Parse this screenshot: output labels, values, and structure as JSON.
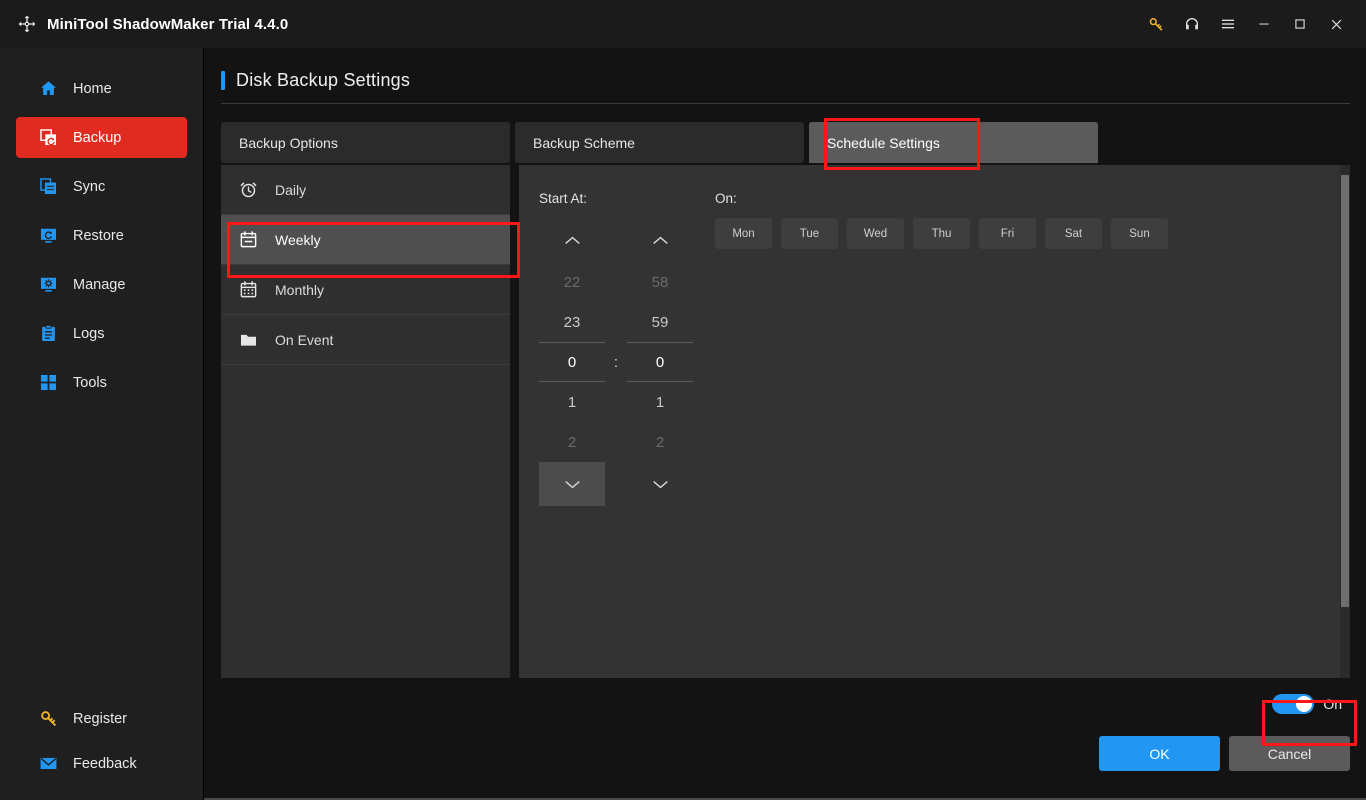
{
  "window": {
    "title": "MiniTool ShadowMaker Trial 4.4.0",
    "logo_icon": "shadowmaker-logo-icon",
    "controls": [
      {
        "name": "key-icon",
        "label": "Register",
        "glyph": "key"
      },
      {
        "name": "headphones-icon",
        "label": "Support",
        "glyph": "headphones"
      },
      {
        "name": "menu-icon",
        "label": "Menu",
        "glyph": "hamburger"
      },
      {
        "name": "minimize-icon",
        "label": "Minimize",
        "glyph": "minimize"
      },
      {
        "name": "maximize-icon",
        "label": "Maximize",
        "glyph": "maximize"
      },
      {
        "name": "close-icon",
        "label": "Close",
        "glyph": "close"
      }
    ]
  },
  "sidebar": {
    "items": [
      {
        "label": "Home",
        "icon": "home-icon",
        "active": false
      },
      {
        "label": "Backup",
        "icon": "backup-icon",
        "active": true
      },
      {
        "label": "Sync",
        "icon": "sync-icon",
        "active": false
      },
      {
        "label": "Restore",
        "icon": "restore-icon",
        "active": false
      },
      {
        "label": "Manage",
        "icon": "manage-icon",
        "active": false
      },
      {
        "label": "Logs",
        "icon": "logs-icon",
        "active": false
      },
      {
        "label": "Tools",
        "icon": "tools-icon",
        "active": false
      }
    ],
    "bottom_items": [
      {
        "label": "Register",
        "icon": "key-icon"
      },
      {
        "label": "Feedback",
        "icon": "mail-icon"
      }
    ]
  },
  "page": {
    "title": "Disk Backup Settings",
    "accent_color": "#2196f3"
  },
  "tabs": [
    {
      "label": "Backup Options",
      "active": false
    },
    {
      "label": "Backup Scheme",
      "active": false
    },
    {
      "label": "Schedule Settings",
      "active": true
    }
  ],
  "schedule_types": [
    {
      "label": "Daily",
      "icon": "alarm-clock-icon",
      "selected": false
    },
    {
      "label": "Weekly",
      "icon": "calendar-week-icon",
      "selected": true
    },
    {
      "label": "Monthly",
      "icon": "calendar-month-icon",
      "selected": false
    },
    {
      "label": "On Event",
      "icon": "folder-icon",
      "selected": false
    }
  ],
  "schedule_panel": {
    "start_at_label": "Start At:",
    "on_label": "On:",
    "time_separator": ":",
    "hours": {
      "above": [
        "22",
        "23"
      ],
      "selected": "0",
      "below": [
        "1",
        "2"
      ]
    },
    "minutes": {
      "above": [
        "58",
        "59"
      ],
      "selected": "0",
      "below": [
        "1",
        "2"
      ]
    },
    "days": [
      {
        "label": "Mon",
        "selected": false
      },
      {
        "label": "Tue",
        "selected": false
      },
      {
        "label": "Wed",
        "selected": false
      },
      {
        "label": "Thu",
        "selected": false
      },
      {
        "label": "Fri",
        "selected": false
      },
      {
        "label": "Sat",
        "selected": false
      },
      {
        "label": "Sun",
        "selected": false
      }
    ]
  },
  "footer": {
    "toggle_label": "On",
    "toggle_on": true,
    "toggle_color": "#2196f3",
    "ok_label": "OK",
    "cancel_label": "Cancel"
  },
  "highlights": {
    "color": "#ff1616",
    "regions": [
      "schedule-settings-tab",
      "weekly-row",
      "enable-toggle"
    ]
  }
}
